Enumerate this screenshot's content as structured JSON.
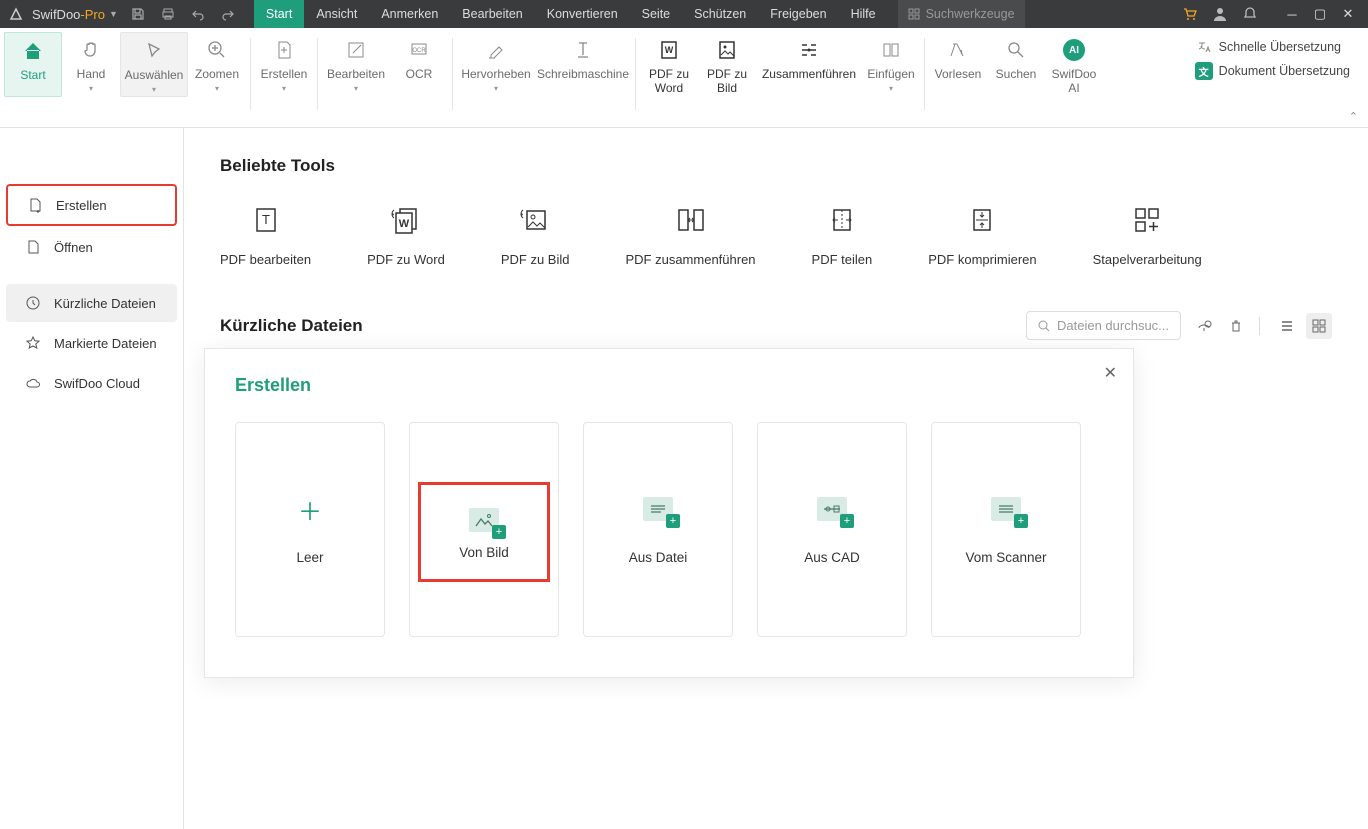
{
  "app": {
    "name1": "SwifDoo",
    "name2": "-Pro"
  },
  "menu": [
    "Start",
    "Ansicht",
    "Anmerken",
    "Bearbeiten",
    "Konvertieren",
    "Seite",
    "Schützen",
    "Freigeben",
    "Hilfe"
  ],
  "searchTools": "Suchwerkzeuge",
  "ribbon": {
    "items": [
      {
        "label": "Start"
      },
      {
        "label": "Hand",
        "drop": true
      },
      {
        "label": "Auswählen",
        "drop": true
      },
      {
        "label": "Zoomen",
        "drop": true
      },
      {
        "label": "Erstellen",
        "drop": true
      },
      {
        "label": "Bearbeiten",
        "drop": true
      },
      {
        "label": "OCR"
      },
      {
        "label": "Hervorheben",
        "drop": true
      },
      {
        "label": "Schreibmaschine"
      },
      {
        "label": "PDF zu Word"
      },
      {
        "label": "PDF zu Bild"
      },
      {
        "label": "Zusammenführen"
      },
      {
        "label": "Einfügen",
        "drop": true
      },
      {
        "label": "Vorlesen"
      },
      {
        "label": "Suchen"
      },
      {
        "label": "SwifDoo AI"
      }
    ],
    "quick": "Schnelle Übersetzung",
    "docTrans": "Dokument Übersetzung"
  },
  "sidebar": {
    "items": [
      {
        "label": "Erstellen"
      },
      {
        "label": "Öffnen"
      },
      {
        "label": "Kürzliche Dateien"
      },
      {
        "label": "Markierte Dateien"
      },
      {
        "label": "SwifDoo Cloud"
      }
    ]
  },
  "content": {
    "popularTitle": "Beliebte Tools",
    "tools": [
      {
        "label": "PDF bearbeiten"
      },
      {
        "label": "PDF zu Word"
      },
      {
        "label": "PDF zu Bild"
      },
      {
        "label": "PDF zusammenführen"
      },
      {
        "label": "PDF teilen"
      },
      {
        "label": "PDF komprimieren"
      },
      {
        "label": "Stapelverarbeitung"
      }
    ],
    "recentTitle": "Kürzliche Dateien",
    "searchPlaceholder": "Dateien durchsuc..."
  },
  "modal": {
    "title": "Erstellen",
    "options": [
      {
        "label": "Leer"
      },
      {
        "label": "Von Bild"
      },
      {
        "label": "Aus Datei"
      },
      {
        "label": "Aus CAD"
      },
      {
        "label": "Vom Scanner"
      }
    ]
  }
}
